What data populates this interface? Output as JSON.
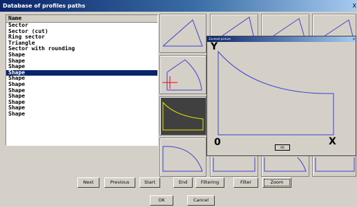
{
  "window": {
    "title": "Database of profiles paths",
    "close": "X"
  },
  "list": {
    "header": "Name",
    "items": [
      "Sector",
      "Sector (cut)",
      "Ring sector",
      "Triangle",
      "Sector with rounding",
      "Shape",
      "Shape",
      "Shape",
      "Shape",
      "Shape",
      "Shape",
      "Shape",
      "Shape",
      "Shape",
      "Shape",
      "Shape"
    ],
    "selected_index": 8
  },
  "zoom": {
    "title": "Zoomed picture",
    "close": "x",
    "y_label": "Y",
    "origin_label": "0",
    "x_label": "X",
    "ok_label": "OK"
  },
  "buttons": {
    "next": "Next",
    "previous": "Previous",
    "start": "Start",
    "end": "End",
    "filtering": "Filtering",
    "filter": "Filter",
    "zoom": "Zoom",
    "ok": "OK",
    "cancel": "Cancel"
  },
  "colors": {
    "selection": "#0a246a",
    "profile_line": "#3f3fcf",
    "highlight_line": "#e8e800",
    "marker": "#ff0000"
  }
}
